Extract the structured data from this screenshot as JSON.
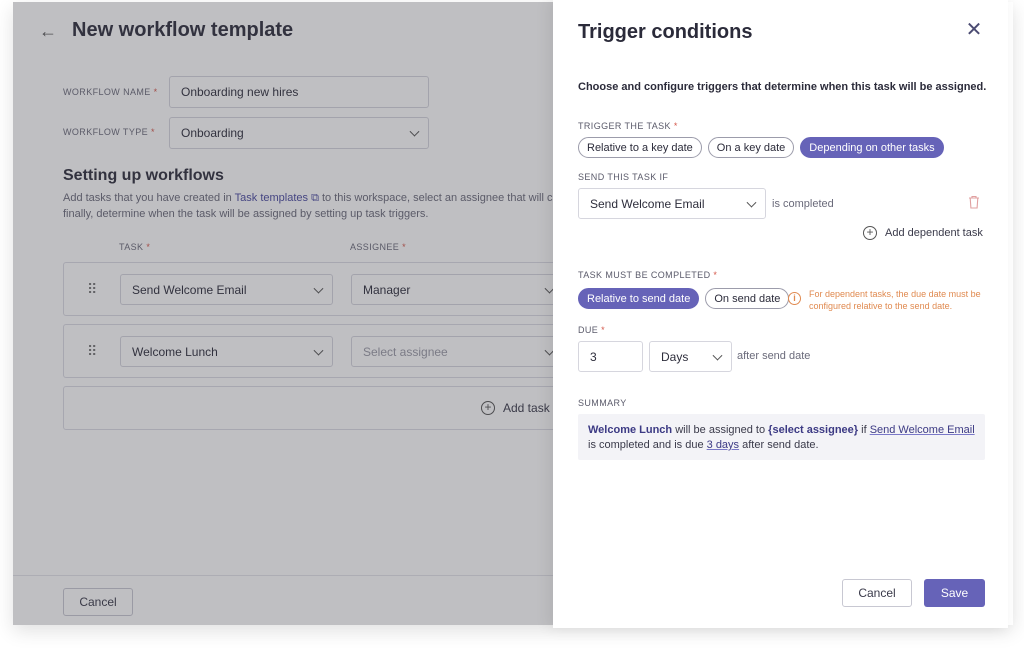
{
  "page": {
    "title": "New workflow template",
    "workflow_name_label": "WORKFLOW NAME",
    "workflow_name_value": "Onboarding new hires",
    "workflow_type_label": "WORKFLOW TYPE",
    "workflow_type_value": "Onboarding",
    "required_mark": "*",
    "section_title": "Setting up workflows",
    "desc_1": "Add tasks that you have created in",
    "desc_link": "Task templates",
    "desc_2": "to this workspace, select an assignee that will ca",
    "desc_3": "finally, determine when the task will be assigned by setting up task triggers.",
    "col_task": "TASK",
    "col_assignee": "ASSIGNEE",
    "rows": [
      {
        "task": "Send Welcome Email",
        "assignee": "Manager"
      },
      {
        "task": "Welcome Lunch",
        "assignee": "Select assignee"
      }
    ],
    "add_task": "Add task",
    "cancel": "Cancel"
  },
  "drawer": {
    "title": "Trigger conditions",
    "intro": "Choose and configure triggers that determine when this task will be assigned.",
    "trigger_label": "TRIGGER THE TASK",
    "trigger_options": [
      "Relative to a key date",
      "On a key date",
      "Depending on other tasks"
    ],
    "trigger_selected": "Depending on other tasks",
    "send_if_label": "SEND THIS TASK IF",
    "send_if_task": "Send Welcome Email",
    "send_if_condition": "is completed",
    "add_dependent": "Add dependent task",
    "must_complete_label": "TASK MUST BE COMPLETED",
    "must_complete_options": [
      "Relative to send date",
      "On send date"
    ],
    "must_complete_selected": "Relative to send date",
    "warning": "For dependent tasks, the due date must be configured relative to the send date.",
    "due_label": "DUE",
    "due_value": "3",
    "due_unit": "Days",
    "due_suffix": "after send date",
    "summary_label": "SUMMARY",
    "summary": {
      "task": "Welcome Lunch",
      "t1": "will be assigned to",
      "assignee": "{select assignee}",
      "t2": "if",
      "dep_task": "Send Welcome Email",
      "t3": "is completed and is due",
      "due": "3 days",
      "t4": "after send date."
    },
    "cancel": "Cancel",
    "save": "Save"
  },
  "colors": {
    "accent": "#6663b8",
    "warning": "#e08a50",
    "required": "#d4574a"
  },
  "icons": [
    "back-arrow-icon",
    "chevron-down-icon",
    "external-link-icon",
    "drag-handle-icon",
    "plus-circle-icon",
    "close-icon",
    "trash-icon",
    "info-icon"
  ]
}
